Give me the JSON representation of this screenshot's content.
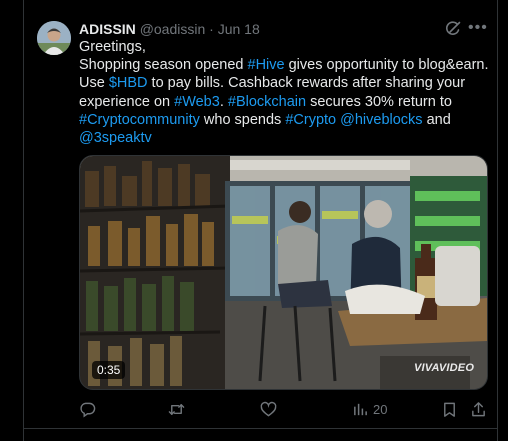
{
  "tweet": {
    "author_name": "ADISSIN",
    "handle": "@oadissin",
    "separator": "·",
    "date": "Jun 18",
    "more_label": "•••",
    "text_lines": [
      [
        {
          "t": "Greetings,"
        }
      ],
      [
        {
          "t": "Shopping season opened "
        },
        {
          "t": "#Hive",
          "tag": true
        },
        {
          "t": " gives opportunity to blog&earn."
        }
      ],
      [
        {
          "t": "Use "
        },
        {
          "t": "$HBD",
          "tag": true
        },
        {
          "t": " to pay bills. Cashback rewards after sharing your"
        }
      ],
      [
        {
          "t": "experience on "
        },
        {
          "t": "#Web3",
          "tag": true
        },
        {
          "t": ". "
        },
        {
          "t": "#Blockchain",
          "tag": true
        },
        {
          "t": " secures 30% return to"
        }
      ],
      [
        {
          "t": "#Cryptocommunity",
          "tag": true
        },
        {
          "t": " who spends "
        },
        {
          "t": "#Crypto",
          "tag": true
        },
        {
          "t": " "
        },
        {
          "t": "@hiveblocks",
          "tag": true
        },
        {
          "t": " and"
        }
      ],
      [
        {
          "t": "@3speaktv",
          "tag": true
        }
      ]
    ],
    "video": {
      "duration": "0:35",
      "watermark": "VIVAVIDEO"
    },
    "actions": {
      "views_count": "20"
    }
  },
  "colors": {
    "background": "#000000",
    "text": "#e7e9ea",
    "muted": "#71767b",
    "accent": "#1d9bf0",
    "border": "#2f3336"
  },
  "icons": [
    "grok-icon",
    "more-icon",
    "reply-icon",
    "retweet-icon",
    "like-icon",
    "views-icon",
    "bookmark-icon",
    "share-icon"
  ]
}
